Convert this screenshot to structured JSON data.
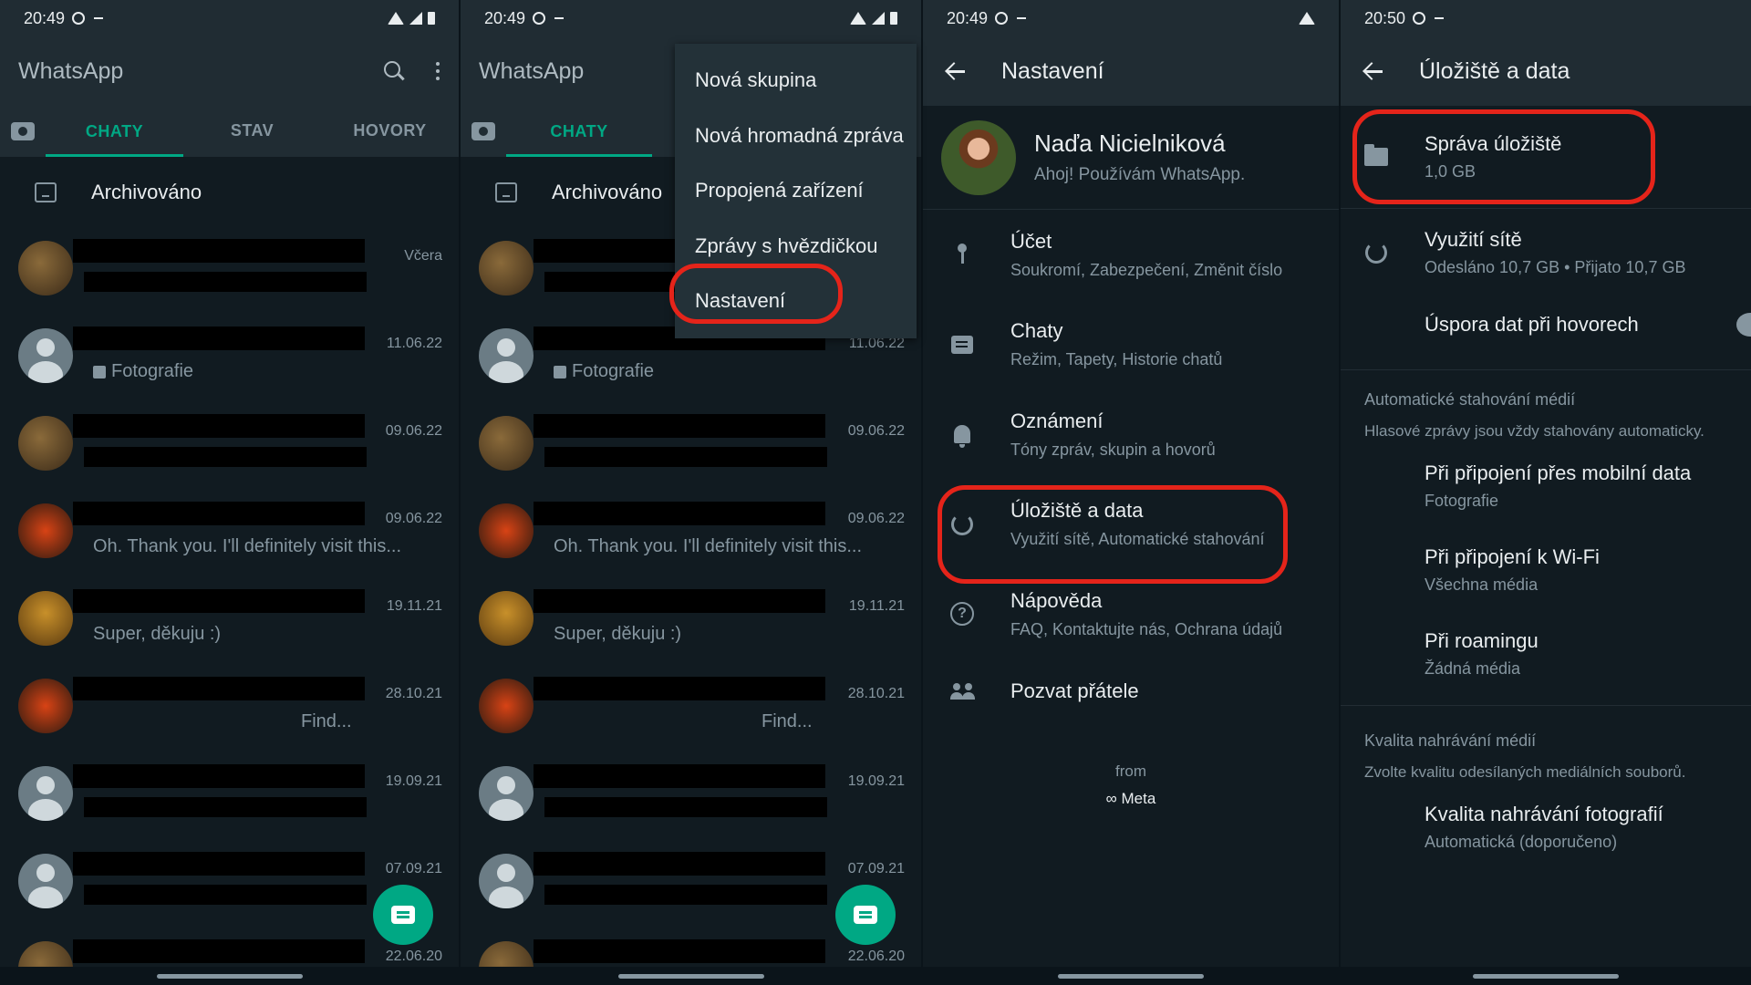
{
  "panel1": {
    "status": {
      "time": "20:49"
    },
    "app_title": "WhatsApp",
    "tabs": [
      "CHATY",
      "STAV",
      "HOVORY"
    ],
    "archived_label": "Archivováno",
    "chats": [
      {
        "date": "Včera",
        "preview": ""
      },
      {
        "date": "11.06.22",
        "preview": "Fotografie"
      },
      {
        "date": "09.06.22",
        "preview": ""
      },
      {
        "date": "09.06.22",
        "preview": "Oh. Thank you. I'll definitely visit this..."
      },
      {
        "date": "19.11.21",
        "preview": "Super, děkuju :)"
      },
      {
        "date": "28.10.21",
        "preview": "Find..."
      },
      {
        "date": "19.09.21",
        "preview": ""
      },
      {
        "date": "07.09.21",
        "preview": ""
      },
      {
        "date": "22.06.20",
        "preview": ""
      }
    ]
  },
  "panel2": {
    "status": {
      "time": "20:49"
    },
    "app_title": "WhatsApp",
    "tabs": [
      "CHATY"
    ],
    "archived_label": "Archivováno",
    "chats": [
      {
        "date": "",
        "preview": ""
      },
      {
        "date": "11.06.22",
        "preview": "Fotografie"
      },
      {
        "date": "09.06.22",
        "preview": ""
      },
      {
        "date": "09.06.22",
        "preview": "Oh. Thank you. I'll definitely visit this..."
      },
      {
        "date": "19.11.21",
        "preview": "Super, děkuju :)"
      },
      {
        "date": "28.10.21",
        "preview": "Find..."
      },
      {
        "date": "19.09.21",
        "preview": ""
      },
      {
        "date": "07.09.21",
        "preview": ""
      },
      {
        "date": "22.06.20",
        "preview": ""
      }
    ],
    "menu": [
      "Nová skupina",
      "Nová hromadná zpráva",
      "Propojená zařízení",
      "Zprávy s hvězdičkou",
      "Nastavení"
    ]
  },
  "panel3": {
    "status": {
      "time": "20:49"
    },
    "title": "Nastavení",
    "profile": {
      "name": "Naďa Nicielniková",
      "status": "Ahoj! Používám WhatsApp."
    },
    "items": [
      {
        "title": "Účet",
        "sub": "Soukromí, Zabezpečení, Změnit číslo",
        "icon": "key-icon"
      },
      {
        "title": "Chaty",
        "sub": "Režim, Tapety, Historie chatů",
        "icon": "chat-icon"
      },
      {
        "title": "Oznámení",
        "sub": "Tóny zpráv, skupin a hovorů",
        "icon": "bell-icon"
      },
      {
        "title": "Úložiště a data",
        "sub": "Využití sítě, Automatické stahování",
        "icon": "data-usage-icon"
      },
      {
        "title": "Nápověda",
        "sub": "FAQ, Kontaktujte nás, Ochrana údajů",
        "icon": "help-icon"
      },
      {
        "title": "Pozvat přátele",
        "sub": "",
        "icon": "people-icon"
      }
    ],
    "from_label": "from",
    "meta_label": "∞ Meta"
  },
  "panel4": {
    "status": {
      "time": "20:50"
    },
    "title": "Úložiště a data",
    "storage": {
      "title": "Správa úložiště",
      "sub": "1,0 GB"
    },
    "network": {
      "title": "Využití sítě",
      "sub": "Odesláno 10,7 GB • Přijato 10,7 GB"
    },
    "call_saver": {
      "title": "Úspora dat při hovorech"
    },
    "auto_download": {
      "heading": "Automatické stahování médií",
      "desc": "Hlasové zprávy jsou vždy stahovány automaticky.",
      "items": [
        {
          "title": "Při připojení přes mobilní data",
          "sub": "Fotografie"
        },
        {
          "title": "Při připojení k Wi-Fi",
          "sub": "Všechna média"
        },
        {
          "title": "Při roamingu",
          "sub": "Žádná média"
        }
      ]
    },
    "upload_quality": {
      "heading": "Kvalita nahrávání médií",
      "desc": "Zvolte kvalitu odesílaných mediálních souborů.",
      "item": {
        "title": "Kvalita nahrávání fotografií",
        "sub": "Automatická (doporučeno)"
      }
    }
  },
  "colors": {
    "accent": "#00a884",
    "highlight": "#e5241a",
    "bg": "#111b21",
    "bar": "#202c33"
  }
}
